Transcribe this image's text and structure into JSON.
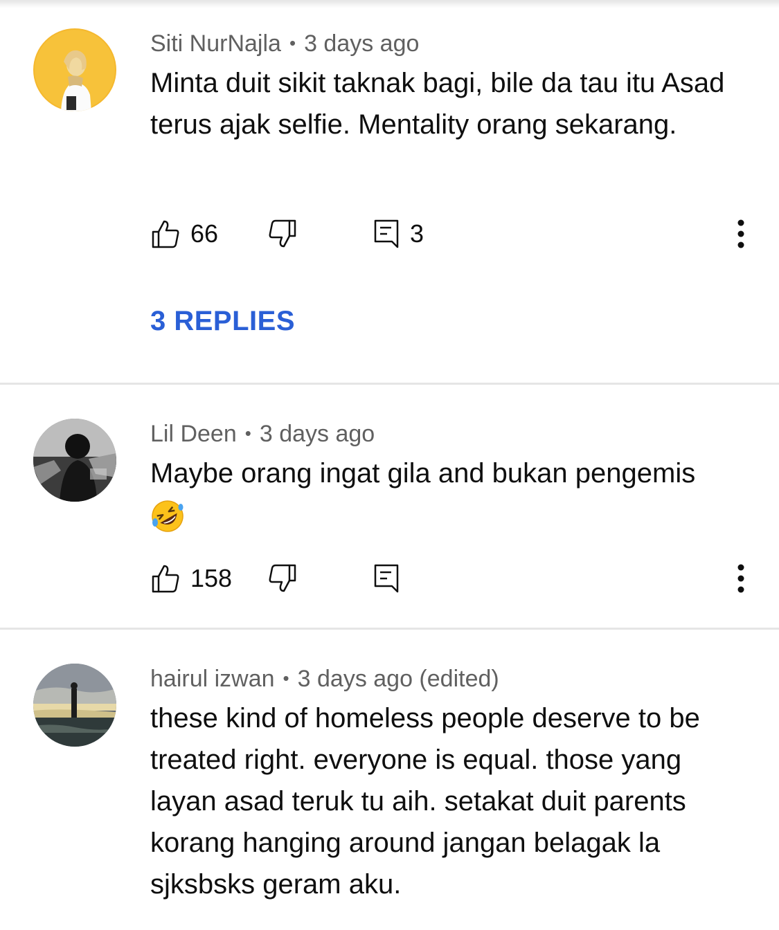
{
  "comments": [
    {
      "author": "Siti NurNajla",
      "separator": "•",
      "time": "3 days ago",
      "text": "Minta duit sikit taknak bagi, bile da tau itu Asad terus ajak selfie. Mentality orang sekarang.",
      "likes": "66",
      "reply_count": "3",
      "replies_link": "3 REPLIES",
      "avatar": "avatar-yellow-portrait"
    },
    {
      "author": "Lil Deen",
      "separator": "•",
      "time": "3 days ago",
      "text": "Maybe orang ingat gila and bukan pengemis",
      "emoji": "rolling-on-floor-laughing-emoji",
      "likes": "158",
      "reply_count": "",
      "avatar": "avatar-silhouette-bw"
    },
    {
      "author": "hairul izwan",
      "separator": "•",
      "time": "3 days ago (edited)",
      "text": "these kind of homeless people deserve to be treated right. everyone is equal. those yang layan asad teruk tu aih. setakat duit parents korang hanging around jangan belagak la sjksbsks geram aku.",
      "avatar": "avatar-beach-sunset"
    }
  ],
  "icons": {
    "like": "thumb-up-icon",
    "dislike": "thumb-down-icon",
    "reply": "comment-reply-icon",
    "more": "more-vert-icon"
  },
  "colors": {
    "link": "#2a5fd6",
    "meta": "#606060",
    "text": "#0f0f0f",
    "divider": "#e5e5e5"
  }
}
